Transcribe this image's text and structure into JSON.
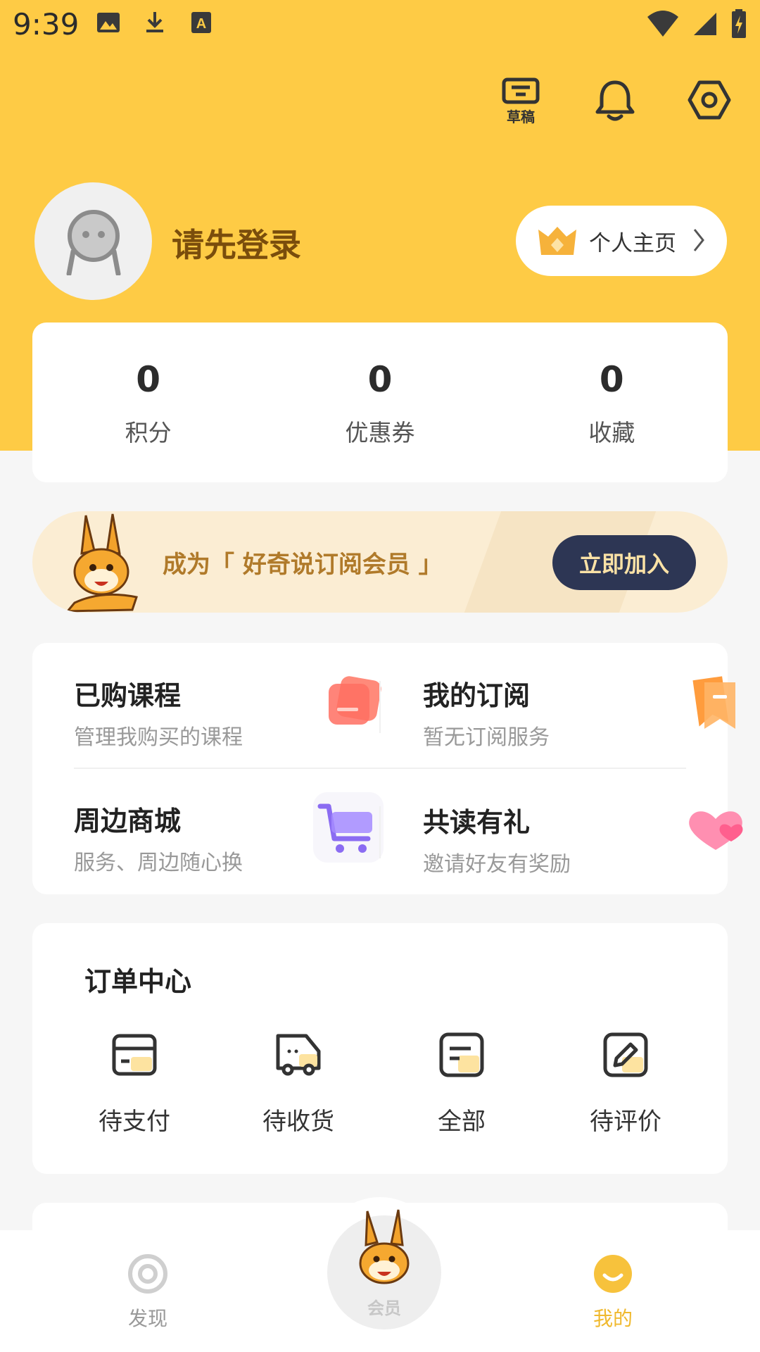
{
  "status_bar": {
    "time": "9:39"
  },
  "header": {
    "draft_label": "草稿"
  },
  "profile": {
    "login_text": "请先登录",
    "homepage_label": "个人主页"
  },
  "stats": [
    {
      "value": "0",
      "label": "积分"
    },
    {
      "value": "0",
      "label": "优惠券"
    },
    {
      "value": "0",
      "label": "收藏"
    }
  ],
  "banner": {
    "text": "成为「 好奇说订阅会员 」",
    "button": "立即加入"
  },
  "features": [
    {
      "title": "已购课程",
      "subtitle": "管理我购买的课程",
      "icon": "cards-icon"
    },
    {
      "title": "我的订阅",
      "subtitle": "暂无订阅服务",
      "icon": "bookmark-icon"
    },
    {
      "title": "周边商城",
      "subtitle": "服务、周边随心换",
      "icon": "cart-icon"
    },
    {
      "title": "共读有礼",
      "subtitle": "邀请好友有奖励",
      "icon": "hearts-icon"
    }
  ],
  "orders": {
    "title": "订单中心",
    "items": [
      {
        "label": "待支付",
        "icon": "card-icon"
      },
      {
        "label": "待收货",
        "icon": "truck-icon"
      },
      {
        "label": "全部",
        "icon": "list-icon"
      },
      {
        "label": "待评价",
        "icon": "edit-icon"
      }
    ]
  },
  "bottom_nav": [
    {
      "label": "发现",
      "icon": "discover-icon"
    },
    {
      "label": "会员",
      "icon": "mascot-icon"
    },
    {
      "label": "我的",
      "icon": "me-icon"
    }
  ],
  "colors": {
    "brand_yellow": "#fecb45",
    "accent_brown": "#7a4d0c",
    "nav_active": "#f7c23c",
    "join_button": "#2d3654"
  }
}
